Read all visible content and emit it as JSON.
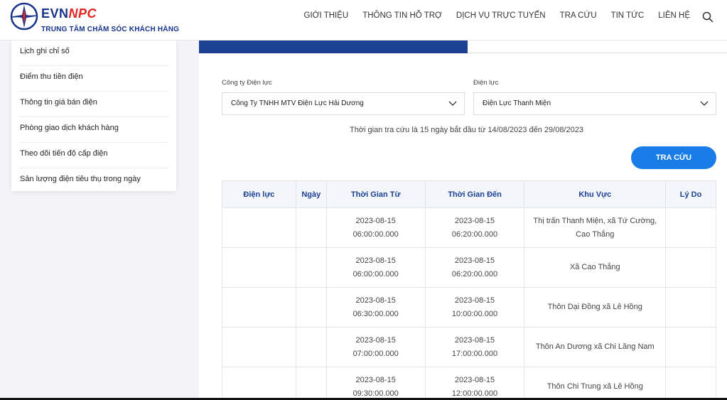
{
  "header": {
    "brand_evn": "EVN",
    "brand_npc": "NPC",
    "subtitle": "TRUNG TÂM CHĂM SÓC KHÁCH HÀNG",
    "nav": [
      "GIỚI THIỆU",
      "THÔNG TIN HỖ TRỢ",
      "DỊCH VỤ TRỰC TUYẾN",
      "TRA CỨU",
      "TIN TỨC",
      "LIÊN HỆ"
    ]
  },
  "sidebar": {
    "items": [
      {
        "label": "Lịch ghi chỉ số"
      },
      {
        "label": "Điểm thu tiền điện"
      },
      {
        "label": "Thông tin giá bán điện"
      },
      {
        "label": "Phòng giao dịch khách hàng"
      },
      {
        "label": "Theo dõi tiến độ cấp điện"
      },
      {
        "label": "Sản lượng điện tiêu thụ trong ngày"
      }
    ]
  },
  "form": {
    "company_label": "Công ty Điện lực",
    "company_value": "Công Ty TNHH MTV Điện Lực Hải Dương",
    "branch_label": "Điện lực",
    "branch_value": "Điện Lực Thanh Miện",
    "period_note": "Thời gian tra cứu là 15 ngày bắt đầu từ 14/08/2023 đến 29/08/2023",
    "search_label": "TRA CỨU"
  },
  "table": {
    "headers": [
      "Điện lực",
      "Ngày",
      "Thời Gian Từ",
      "Thời Gian Đến",
      "Khu Vực",
      "Lý Do"
    ],
    "rows": [
      {
        "dien_luc": "",
        "ngay": "",
        "tu_date": "2023-08-15",
        "tu_time": "06:00:00.000",
        "den_date": "2023-08-15",
        "den_time": "06:20:00.000",
        "khu_vuc": "Thị trấn Thanh Miện, xã Tứ Cường, Cao Thắng",
        "ly_do": ""
      },
      {
        "dien_luc": "",
        "ngay": "",
        "tu_date": "2023-08-15",
        "tu_time": "06:00:00.000",
        "den_date": "2023-08-15",
        "den_time": "06:20:00.000",
        "khu_vuc": "Xã Cao Thắng",
        "ly_do": ""
      },
      {
        "dien_luc": "",
        "ngay": "",
        "tu_date": "2023-08-15",
        "tu_time": "06:30:00.000",
        "den_date": "2023-08-15",
        "den_time": "10:00:00.000",
        "khu_vuc": "Thôn Dại Đồng xã Lê Hồng",
        "ly_do": ""
      },
      {
        "dien_luc": "",
        "ngay": "",
        "tu_date": "2023-08-15",
        "tu_time": "07:00:00.000",
        "den_date": "2023-08-15",
        "den_time": "17:00:00.000",
        "khu_vuc": "Thôn An Dương xã Chi Lăng Nam",
        "ly_do": ""
      },
      {
        "dien_luc": "",
        "ngay": "",
        "tu_date": "2023-08-15",
        "tu_time": "09:30:00.000",
        "den_date": "2023-08-15",
        "den_time": "12:00:00.000",
        "khu_vuc": "Thôn Chi Trung xã Lê Hồng",
        "ly_do": ""
      }
    ]
  },
  "colors": {
    "brand_blue": "#17338b",
    "brand_red": "#e02323",
    "accent_blue": "#1a7ce6",
    "tab_blue": "#1d4193"
  }
}
